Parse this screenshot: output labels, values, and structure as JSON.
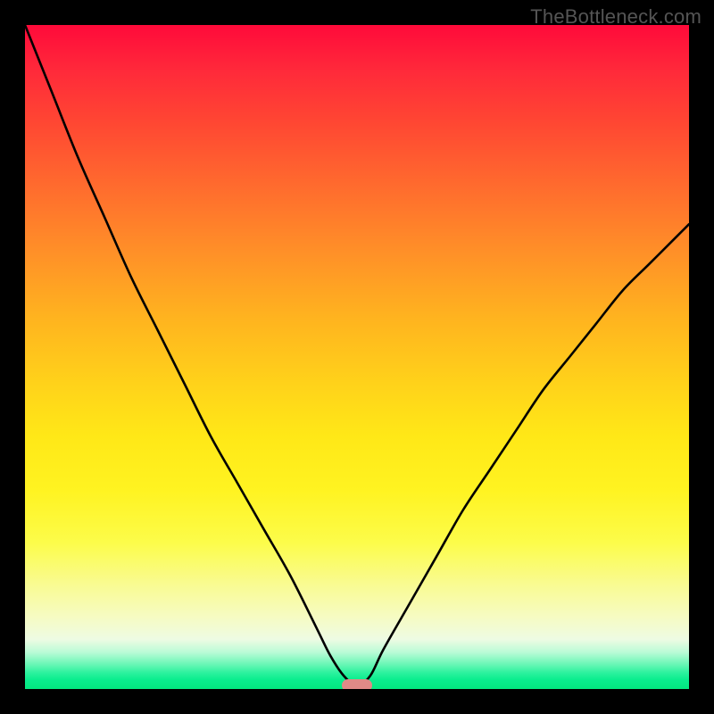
{
  "watermark": "TheBottleneck.com",
  "colors": {
    "frame_bg": "#000000",
    "curve_stroke": "#000000",
    "marker_fill": "#e08a87",
    "gradient_top": "#ff0a3a",
    "gradient_bottom": "#03e77f"
  },
  "chart_data": {
    "type": "line",
    "title": "",
    "xlabel": "",
    "ylabel": "",
    "xlim": [
      0,
      100
    ],
    "ylim": [
      0,
      100
    ],
    "grid": false,
    "legend": false,
    "series": [
      {
        "name": "bottleneck-curve",
        "x": [
          0,
          4,
          8,
          12,
          16,
          20,
          24,
          28,
          32,
          36,
          40,
          44,
          46,
          48,
          50,
          52,
          54,
          58,
          62,
          66,
          70,
          74,
          78,
          82,
          86,
          90,
          94,
          98,
          100
        ],
        "y": [
          100,
          90,
          80,
          71,
          62,
          54,
          46,
          38,
          31,
          24,
          17,
          9,
          5,
          2,
          0.5,
          2,
          6,
          13,
          20,
          27,
          33,
          39,
          45,
          50,
          55,
          60,
          64,
          68,
          70
        ]
      }
    ],
    "marker": {
      "x": 50,
      "y": 0.5,
      "label": ""
    },
    "notes": "Gradient background encodes bottleneck severity: red = 100%, green = 0%. Curve shows % bottleneck vs. an implicit x-axis parameter (e.g., resolution or component pairing). Axis tick labels are not rendered in the source image; values are estimates from curve geometry."
  }
}
